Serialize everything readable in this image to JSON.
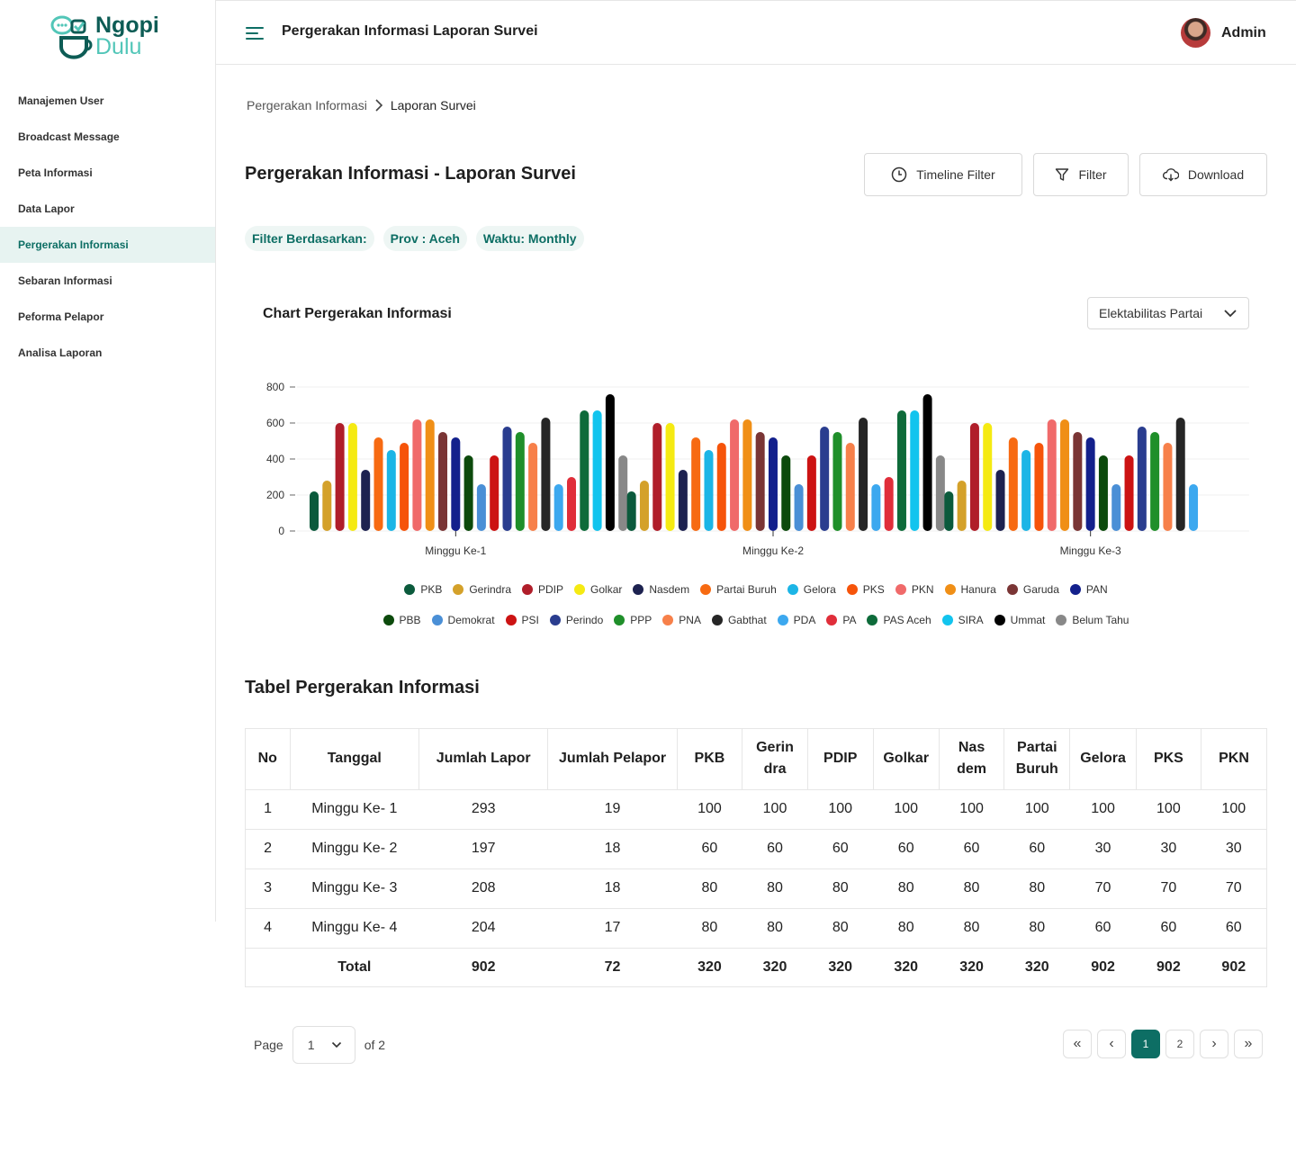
{
  "app": {
    "logo_line1": "Ngopi",
    "logo_line2": "Dulu"
  },
  "sidebar": {
    "items": [
      {
        "label": "Manajemen User",
        "active": false
      },
      {
        "label": "Broadcast Message",
        "active": false
      },
      {
        "label": "Peta Informasi",
        "active": false
      },
      {
        "label": "Data Lapor",
        "active": false
      },
      {
        "label": "Pergerakan Informasi",
        "active": true
      },
      {
        "label": "Sebaran Informasi",
        "active": false
      },
      {
        "label": "Peforma Pelapor",
        "active": false
      },
      {
        "label": "Analisa Laporan",
        "active": false
      }
    ]
  },
  "header": {
    "title": "Pergerakan Informasi Laporan Survei",
    "user": "Admin"
  },
  "breadcrumb": {
    "parent": "Pergerakan Informasi",
    "current": "Laporan Survei"
  },
  "page": {
    "title": "Pergerakan Informasi - Laporan Survei"
  },
  "actions": {
    "timeline": "Timeline Filter",
    "filter": "Filter",
    "download": "Download"
  },
  "filters": {
    "label": "Filter Berdasarkan:",
    "prov": "Prov : Aceh",
    "time": "Waktu: Monthly"
  },
  "chart_section": {
    "title": "Chart Pergerakan Informasi",
    "dropdown": "Elektabilitas Partai"
  },
  "chart_data": {
    "type": "bar",
    "title": "",
    "xlabel": "",
    "ylabel": "",
    "ylim": [
      0,
      800
    ],
    "yticks": [
      0,
      200,
      400,
      600,
      800
    ],
    "grid": true,
    "legend_position": "bottom",
    "categories": [
      "Minggu Ke-1",
      "Minggu Ke-2",
      "Minggu Ke-3"
    ],
    "series": [
      {
        "name": "PKB",
        "color": "#0b5a3c",
        "values": [
          220,
          220,
          220
        ]
      },
      {
        "name": "Gerindra",
        "color": "#d4a12a",
        "values": [
          280,
          280,
          280
        ]
      },
      {
        "name": "PDIP",
        "color": "#b01e2a",
        "values": [
          600,
          600,
          600
        ]
      },
      {
        "name": "Golkar",
        "color": "#f5ea12",
        "values": [
          600,
          600,
          600
        ]
      },
      {
        "name": "Nasdem",
        "color": "#1d2250",
        "values": [
          340,
          340,
          340
        ]
      },
      {
        "name": "Partai Buruh",
        "color": "#f76a12",
        "values": [
          520,
          520,
          520
        ]
      },
      {
        "name": "Gelora",
        "color": "#1cb5e6",
        "values": [
          450,
          450,
          450
        ]
      },
      {
        "name": "PKS",
        "color": "#f6540a",
        "values": [
          490,
          490,
          490
        ]
      },
      {
        "name": "PKN",
        "color": "#f06a6a",
        "values": [
          620,
          620,
          620
        ]
      },
      {
        "name": "Hanura",
        "color": "#f08f16",
        "values": [
          620,
          620,
          620
        ]
      },
      {
        "name": "Garuda",
        "color": "#7a3535",
        "values": [
          550,
          550,
          550
        ]
      },
      {
        "name": "PAN",
        "color": "#13208c",
        "values": [
          520,
          520,
          520
        ]
      },
      {
        "name": "PBB",
        "color": "#0c4a0c",
        "values": [
          420,
          420,
          420
        ]
      },
      {
        "name": "Demokrat",
        "color": "#4a8fd6",
        "values": [
          260,
          260,
          260
        ]
      },
      {
        "name": "PSI",
        "color": "#cc1313",
        "values": [
          420,
          420,
          420
        ]
      },
      {
        "name": "Perindo",
        "color": "#2a3d8f",
        "values": [
          580,
          580,
          580
        ]
      },
      {
        "name": "PPP",
        "color": "#1f8f2a",
        "values": [
          550,
          550,
          550
        ]
      },
      {
        "name": "PNA",
        "color": "#f7804a",
        "values": [
          490,
          490,
          490
        ]
      },
      {
        "name": "Gabthat",
        "color": "#262626",
        "values": [
          630,
          630,
          630
        ]
      },
      {
        "name": "PDA",
        "color": "#3ca8ef",
        "values": [
          260,
          260,
          260
        ]
      },
      {
        "name": "PA",
        "color": "#e02e3a",
        "values": [
          300,
          300,
          0
        ]
      },
      {
        "name": "PAS Aceh",
        "color": "#0e6b3a",
        "values": [
          670,
          670,
          0
        ]
      },
      {
        "name": "SIRA",
        "color": "#12c4ee",
        "values": [
          670,
          670,
          0
        ]
      },
      {
        "name": "Ummat",
        "color": "#000000",
        "values": [
          760,
          760,
          0
        ]
      },
      {
        "name": "Belum Tahu",
        "color": "#888888",
        "values": [
          420,
          420,
          0
        ]
      }
    ]
  },
  "table_section": {
    "title": "Tabel Pergerakan Informasi",
    "columns": [
      "No",
      "Tanggal",
      "Jumlah Lapor",
      "Jumlah Pelapor",
      "PKB",
      "Gerin dra",
      "PDIP",
      "Golkar",
      "Nas dem",
      "Partai Buruh",
      "Gelora",
      "PKS",
      "PKN"
    ],
    "rows": [
      [
        "1",
        "Minggu Ke- 1",
        "293",
        "19",
        "100",
        "100",
        "100",
        "100",
        "100",
        "100",
        "100",
        "100",
        "100"
      ],
      [
        "2",
        "Minggu Ke- 2",
        "197",
        "18",
        "60",
        "60",
        "60",
        "60",
        "60",
        "60",
        "30",
        "30",
        "30"
      ],
      [
        "3",
        "Minggu Ke- 3",
        "208",
        "18",
        "80",
        "80",
        "80",
        "80",
        "80",
        "80",
        "70",
        "70",
        "70"
      ],
      [
        "4",
        "Minggu Ke- 4",
        "204",
        "17",
        "80",
        "80",
        "80",
        "80",
        "80",
        "80",
        "60",
        "60",
        "60"
      ]
    ],
    "total": [
      "",
      "Total",
      "902",
      "72",
      "320",
      "320",
      "320",
      "320",
      "320",
      "320",
      "902",
      "902",
      "902"
    ]
  },
  "pagination": {
    "page_label": "Page",
    "current": "1",
    "of_label": "of 2",
    "buttons": [
      "«",
      "‹",
      "1",
      "2",
      "›",
      "»"
    ],
    "active_page": "1"
  }
}
